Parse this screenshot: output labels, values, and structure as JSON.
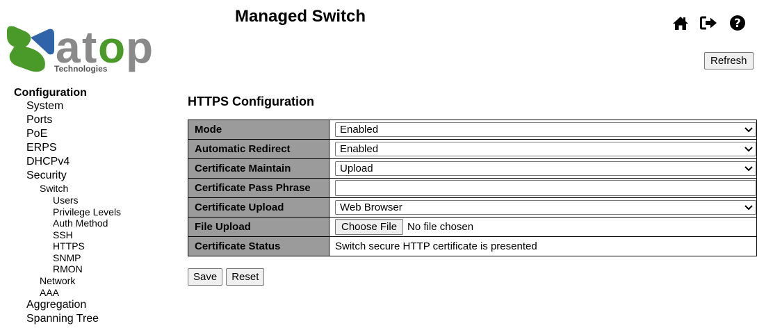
{
  "header": {
    "title": "Managed Switch",
    "logo_text": "atop",
    "logo_subtext": "Technologies",
    "icons": [
      "home-icon",
      "logout-icon",
      "help-icon"
    ],
    "refresh_label": "Refresh"
  },
  "colors": {
    "logo_green": "#4a9a2a",
    "logo_blue": "#2f64a8",
    "logo_gray": "#8a8a8a",
    "label_bg": "#9b9b9b"
  },
  "sidebar": {
    "root": "Configuration",
    "items": [
      {
        "label": "System",
        "level": 1
      },
      {
        "label": "Ports",
        "level": 1
      },
      {
        "label": "PoE",
        "level": 1
      },
      {
        "label": "ERPS",
        "level": 1
      },
      {
        "label": "DHCPv4",
        "level": 1
      },
      {
        "label": "Security",
        "level": 1
      },
      {
        "label": "Switch",
        "level": 2
      },
      {
        "label": "Users",
        "level": 3
      },
      {
        "label": "Privilege Levels",
        "level": 3
      },
      {
        "label": "Auth Method",
        "level": 3
      },
      {
        "label": "SSH",
        "level": 3
      },
      {
        "label": "HTTPS",
        "level": 3
      },
      {
        "label": "SNMP",
        "level": 3
      },
      {
        "label": "RMON",
        "level": 3
      },
      {
        "label": "Network",
        "level": 2
      },
      {
        "label": "AAA",
        "level": 2
      },
      {
        "label": "Aggregation",
        "level": 1
      },
      {
        "label": "Spanning Tree",
        "level": 1
      }
    ]
  },
  "main": {
    "title": "HTTPS Configuration",
    "rows": {
      "mode": {
        "label": "Mode",
        "value": "Enabled"
      },
      "redirect": {
        "label": "Automatic Redirect",
        "value": "Enabled"
      },
      "maintain": {
        "label": "Certificate Maintain",
        "value": "Upload"
      },
      "passphrase": {
        "label": "Certificate Pass Phrase",
        "value": ""
      },
      "upload": {
        "label": "Certificate Upload",
        "value": "Web Browser"
      },
      "file": {
        "label": "File Upload",
        "button": "Choose File",
        "status": "No file chosen"
      },
      "status": {
        "label": "Certificate Status",
        "value": "Switch secure HTTP certificate is presented"
      }
    },
    "save_label": "Save",
    "reset_label": "Reset"
  }
}
